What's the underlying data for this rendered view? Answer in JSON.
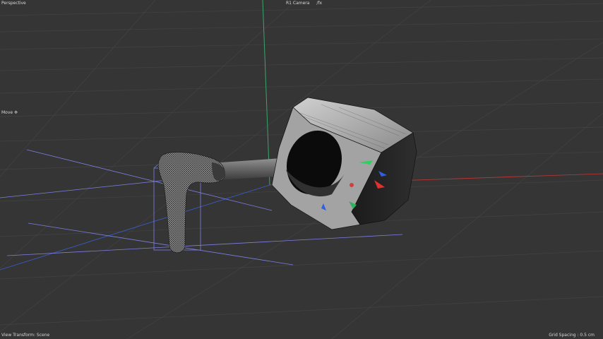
{
  "viewport": {
    "view_name": "Perspective",
    "camera_name": "R1 Camera",
    "camera_button": "/fx",
    "tool_label": "Move",
    "tool_icon": "move-cross-icon",
    "view_transform": "View Transform: Scene",
    "grid_spacing": "Grid Spacing : 0.5 cm"
  },
  "colors": {
    "background": "#353535",
    "axis_x": "#c03838",
    "axis_y": "#3aa46a",
    "axis_z": "#3a5ed0",
    "bounding_box": "#8a8cff",
    "mesh_light": "#bdbdbd",
    "mesh_dark": "#1a1a1a"
  }
}
